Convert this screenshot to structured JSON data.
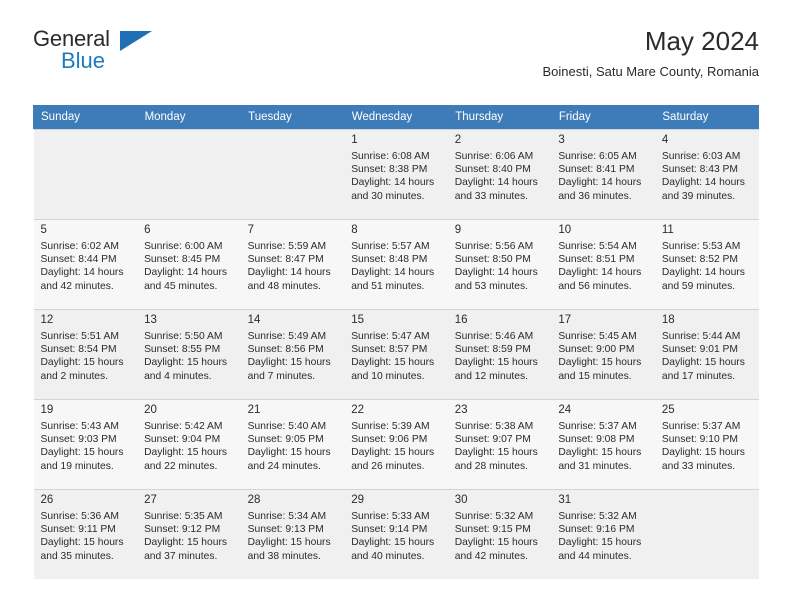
{
  "brand": {
    "name_top": "General",
    "name_bottom": "Blue"
  },
  "header": {
    "title": "May 2024",
    "subtitle": "Boinesti, Satu Mare County, Romania"
  },
  "colors": {
    "header_blue": "#3d7cb8",
    "brand_blue": "#1f7ac0",
    "text": "#2b2b2b",
    "cell_shade": "#f0f0f0"
  },
  "weekdays": [
    "Sunday",
    "Monday",
    "Tuesday",
    "Wednesday",
    "Thursday",
    "Friday",
    "Saturday"
  ],
  "labels": {
    "sunrise": "Sunrise:",
    "sunset": "Sunset:",
    "daylight": "Daylight:"
  },
  "weeks": [
    [
      {
        "day": "",
        "empty": true
      },
      {
        "day": "",
        "empty": true
      },
      {
        "day": "",
        "empty": true
      },
      {
        "day": "1",
        "sunrise": "Sunrise: 6:08 AM",
        "sunset": "Sunset: 8:38 PM",
        "daylight1": "Daylight: 14 hours",
        "daylight2": "and 30 minutes."
      },
      {
        "day": "2",
        "sunrise": "Sunrise: 6:06 AM",
        "sunset": "Sunset: 8:40 PM",
        "daylight1": "Daylight: 14 hours",
        "daylight2": "and 33 minutes."
      },
      {
        "day": "3",
        "sunrise": "Sunrise: 6:05 AM",
        "sunset": "Sunset: 8:41 PM",
        "daylight1": "Daylight: 14 hours",
        "daylight2": "and 36 minutes."
      },
      {
        "day": "4",
        "sunrise": "Sunrise: 6:03 AM",
        "sunset": "Sunset: 8:43 PM",
        "daylight1": "Daylight: 14 hours",
        "daylight2": "and 39 minutes."
      }
    ],
    [
      {
        "day": "5",
        "sunrise": "Sunrise: 6:02 AM",
        "sunset": "Sunset: 8:44 PM",
        "daylight1": "Daylight: 14 hours",
        "daylight2": "and 42 minutes."
      },
      {
        "day": "6",
        "sunrise": "Sunrise: 6:00 AM",
        "sunset": "Sunset: 8:45 PM",
        "daylight1": "Daylight: 14 hours",
        "daylight2": "and 45 minutes."
      },
      {
        "day": "7",
        "sunrise": "Sunrise: 5:59 AM",
        "sunset": "Sunset: 8:47 PM",
        "daylight1": "Daylight: 14 hours",
        "daylight2": "and 48 minutes."
      },
      {
        "day": "8",
        "sunrise": "Sunrise: 5:57 AM",
        "sunset": "Sunset: 8:48 PM",
        "daylight1": "Daylight: 14 hours",
        "daylight2": "and 51 minutes."
      },
      {
        "day": "9",
        "sunrise": "Sunrise: 5:56 AM",
        "sunset": "Sunset: 8:50 PM",
        "daylight1": "Daylight: 14 hours",
        "daylight2": "and 53 minutes."
      },
      {
        "day": "10",
        "sunrise": "Sunrise: 5:54 AM",
        "sunset": "Sunset: 8:51 PM",
        "daylight1": "Daylight: 14 hours",
        "daylight2": "and 56 minutes."
      },
      {
        "day": "11",
        "sunrise": "Sunrise: 5:53 AM",
        "sunset": "Sunset: 8:52 PM",
        "daylight1": "Daylight: 14 hours",
        "daylight2": "and 59 minutes."
      }
    ],
    [
      {
        "day": "12",
        "sunrise": "Sunrise: 5:51 AM",
        "sunset": "Sunset: 8:54 PM",
        "daylight1": "Daylight: 15 hours",
        "daylight2": "and 2 minutes."
      },
      {
        "day": "13",
        "sunrise": "Sunrise: 5:50 AM",
        "sunset": "Sunset: 8:55 PM",
        "daylight1": "Daylight: 15 hours",
        "daylight2": "and 4 minutes."
      },
      {
        "day": "14",
        "sunrise": "Sunrise: 5:49 AM",
        "sunset": "Sunset: 8:56 PM",
        "daylight1": "Daylight: 15 hours",
        "daylight2": "and 7 minutes."
      },
      {
        "day": "15",
        "sunrise": "Sunrise: 5:47 AM",
        "sunset": "Sunset: 8:57 PM",
        "daylight1": "Daylight: 15 hours",
        "daylight2": "and 10 minutes."
      },
      {
        "day": "16",
        "sunrise": "Sunrise: 5:46 AM",
        "sunset": "Sunset: 8:59 PM",
        "daylight1": "Daylight: 15 hours",
        "daylight2": "and 12 minutes."
      },
      {
        "day": "17",
        "sunrise": "Sunrise: 5:45 AM",
        "sunset": "Sunset: 9:00 PM",
        "daylight1": "Daylight: 15 hours",
        "daylight2": "and 15 minutes."
      },
      {
        "day": "18",
        "sunrise": "Sunrise: 5:44 AM",
        "sunset": "Sunset: 9:01 PM",
        "daylight1": "Daylight: 15 hours",
        "daylight2": "and 17 minutes."
      }
    ],
    [
      {
        "day": "19",
        "sunrise": "Sunrise: 5:43 AM",
        "sunset": "Sunset: 9:03 PM",
        "daylight1": "Daylight: 15 hours",
        "daylight2": "and 19 minutes."
      },
      {
        "day": "20",
        "sunrise": "Sunrise: 5:42 AM",
        "sunset": "Sunset: 9:04 PM",
        "daylight1": "Daylight: 15 hours",
        "daylight2": "and 22 minutes."
      },
      {
        "day": "21",
        "sunrise": "Sunrise: 5:40 AM",
        "sunset": "Sunset: 9:05 PM",
        "daylight1": "Daylight: 15 hours",
        "daylight2": "and 24 minutes."
      },
      {
        "day": "22",
        "sunrise": "Sunrise: 5:39 AM",
        "sunset": "Sunset: 9:06 PM",
        "daylight1": "Daylight: 15 hours",
        "daylight2": "and 26 minutes."
      },
      {
        "day": "23",
        "sunrise": "Sunrise: 5:38 AM",
        "sunset": "Sunset: 9:07 PM",
        "daylight1": "Daylight: 15 hours",
        "daylight2": "and 28 minutes."
      },
      {
        "day": "24",
        "sunrise": "Sunrise: 5:37 AM",
        "sunset": "Sunset: 9:08 PM",
        "daylight1": "Daylight: 15 hours",
        "daylight2": "and 31 minutes."
      },
      {
        "day": "25",
        "sunrise": "Sunrise: 5:37 AM",
        "sunset": "Sunset: 9:10 PM",
        "daylight1": "Daylight: 15 hours",
        "daylight2": "and 33 minutes."
      }
    ],
    [
      {
        "day": "26",
        "sunrise": "Sunrise: 5:36 AM",
        "sunset": "Sunset: 9:11 PM",
        "daylight1": "Daylight: 15 hours",
        "daylight2": "and 35 minutes."
      },
      {
        "day": "27",
        "sunrise": "Sunrise: 5:35 AM",
        "sunset": "Sunset: 9:12 PM",
        "daylight1": "Daylight: 15 hours",
        "daylight2": "and 37 minutes."
      },
      {
        "day": "28",
        "sunrise": "Sunrise: 5:34 AM",
        "sunset": "Sunset: 9:13 PM",
        "daylight1": "Daylight: 15 hours",
        "daylight2": "and 38 minutes."
      },
      {
        "day": "29",
        "sunrise": "Sunrise: 5:33 AM",
        "sunset": "Sunset: 9:14 PM",
        "daylight1": "Daylight: 15 hours",
        "daylight2": "and 40 minutes."
      },
      {
        "day": "30",
        "sunrise": "Sunrise: 5:32 AM",
        "sunset": "Sunset: 9:15 PM",
        "daylight1": "Daylight: 15 hours",
        "daylight2": "and 42 minutes."
      },
      {
        "day": "31",
        "sunrise": "Sunrise: 5:32 AM",
        "sunset": "Sunset: 9:16 PM",
        "daylight1": "Daylight: 15 hours",
        "daylight2": "and 44 minutes."
      },
      {
        "day": "",
        "empty": true
      }
    ]
  ]
}
